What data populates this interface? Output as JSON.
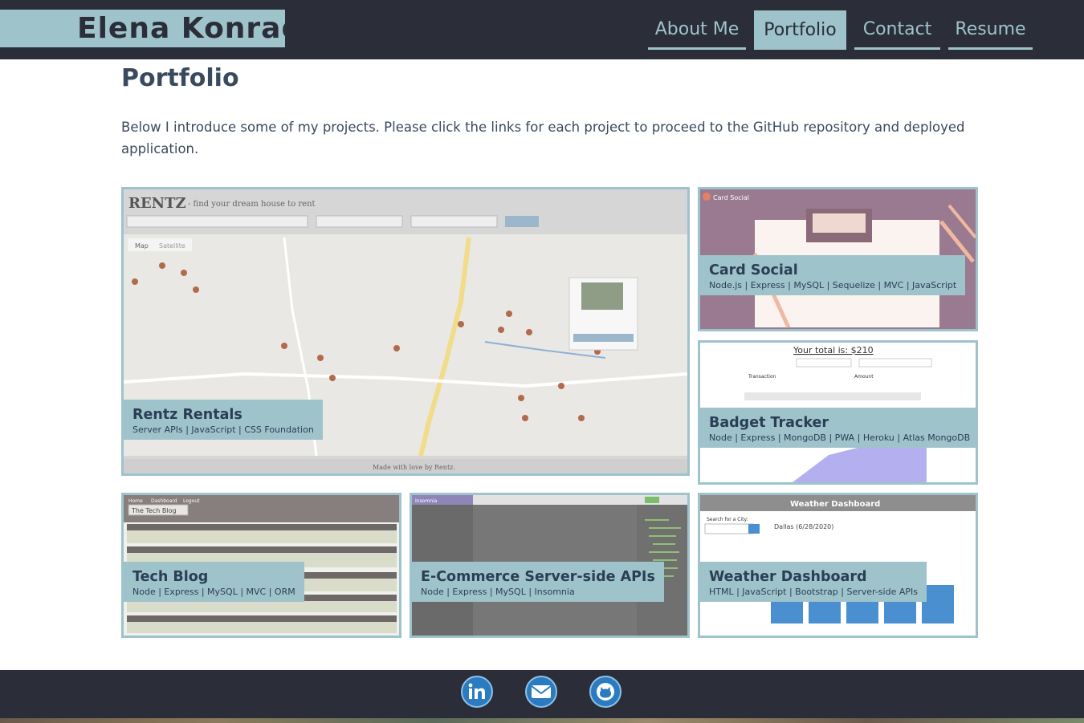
{
  "header": {
    "brand": "Elena Konradi",
    "nav": [
      {
        "label": "About Me"
      },
      {
        "label": "Portfolio"
      },
      {
        "label": "Contact"
      },
      {
        "label": "Resume"
      }
    ]
  },
  "main": {
    "title": "Portfolio",
    "intro": "Below I introduce some of my projects. Please click the links for each project to proceed to the GitHub repository and deployed application."
  },
  "projects": [
    {
      "title": "Rentz Rentals",
      "tech": "Server APIs | JavaScript | CSS Foundation",
      "shot_logo": "RENTZ",
      "shot_tagline": "- find your dream house to rent",
      "shot_footer": "Made with love by Rentz.",
      "shot_map_tabs": [
        "Map",
        "Satellite"
      ]
    },
    {
      "title": "Card Social",
      "tech": "Node.js | Express | MySQL | Sequelize | MVC | JavaScript",
      "shot_title": "Card Social"
    },
    {
      "title": "Badget Tracker",
      "tech": "Node | Express | MongoDB | PWA | Heroku | Atlas MongoDB",
      "shot_total": "Your total is: $210",
      "shot_col_1": "Transaction",
      "shot_col_2": "Amount"
    },
    {
      "title": "Tech Blog",
      "tech": "Node | Express | MySQL | MVC | ORM",
      "shot_brand": "The Tech Blog",
      "shot_nav": [
        "Home",
        "Dashboard",
        "Logout"
      ]
    },
    {
      "title": "E-Commerce Server-side APIs",
      "tech": "Node | Express | MySQL | Insomnia",
      "shot_app": "Insomnia"
    },
    {
      "title": "Weather Dashboard",
      "tech": "HTML | JavaScript | Bootstrap | Server-side APIs",
      "shot_header": "Weather Dashboard",
      "shot_search": "Search for a City:",
      "shot_city": "Dallas (6/28/2020)"
    }
  ],
  "footer": {
    "icons": [
      "linkedin-icon",
      "email-icon",
      "github-icon"
    ]
  },
  "colors": {
    "dark": "#2b2e38",
    "accent": "#9ec3cb",
    "text": "#3a4a5e"
  }
}
